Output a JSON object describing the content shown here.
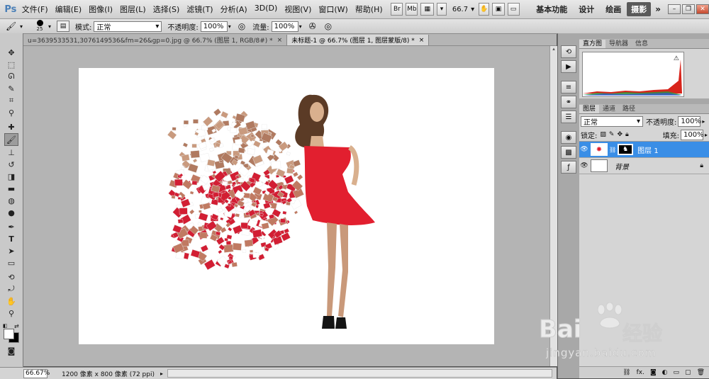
{
  "app": {
    "logo": "Ps"
  },
  "menu": [
    "文件(F)",
    "编辑(E)",
    "图像(I)",
    "图层(L)",
    "选择(S)",
    "滤镜(T)",
    "分析(A)",
    "3D(D)",
    "视图(V)",
    "窗口(W)",
    "帮助(H)"
  ],
  "menubar_buttons": {
    "br": "Br",
    "mb": "Mb",
    "zoom": "66.7"
  },
  "workspaces": [
    "基本功能",
    "设计",
    "绘画",
    "摄影"
  ],
  "workspace_more": "»",
  "options": {
    "brush_size": "25",
    "mode_label": "模式:",
    "mode_value": "正常",
    "opacity_label": "不透明度:",
    "opacity_value": "100%",
    "flow_label": "流量:",
    "flow_value": "100%"
  },
  "doc_tabs": [
    {
      "title": "u=3639533531,3076149536&fm=26&gp=0.jpg @ 66.7% (图层 1, RGB/8#) *",
      "close": "×"
    },
    {
      "title": "未标题-1 @ 66.7% (图层 1, 图层蒙版/8) *",
      "close": "×"
    }
  ],
  "status": {
    "zoom": "66.67%",
    "doc_info": "1200 像素 x 800 像素 (72 ppi)"
  },
  "panel_top_tabs": [
    "直方图",
    "导航器",
    "信息"
  ],
  "layers_panel": {
    "tabs": [
      "图层",
      "通道",
      "路径"
    ],
    "blend_mode": "正常",
    "opacity_label": "不透明度:",
    "opacity_value": "100%",
    "lock_label": "锁定:",
    "fill_label": "填充:",
    "fill_value": "100%",
    "layers": [
      {
        "name": "图层 1",
        "selected": true
      },
      {
        "name": "背景",
        "selected": false
      }
    ],
    "bottom_icons": [
      "link-icon",
      "fx-icon",
      "mask-icon",
      "adjustment-icon",
      "group-icon",
      "new-layer-icon",
      "trash-icon"
    ],
    "fx_label": "fx."
  },
  "watermark": {
    "line1": "Bai",
    "line2": "经验",
    "url": "jingyan.baidu.com"
  },
  "colors": {
    "dress_red": "#e21f2f",
    "selection_blue": "#3a8ee6",
    "histogram_red": "#d8241b"
  }
}
